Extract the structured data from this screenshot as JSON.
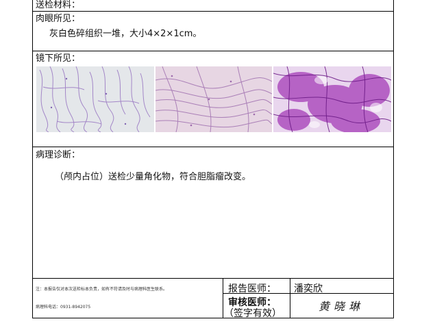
{
  "sections": {
    "specimen": {
      "label": "送检材料："
    },
    "gross": {
      "label": "肉眼所见：",
      "text": "灰白色碎组织一堆，大小4×2×1cm。"
    },
    "microscopic": {
      "label": "镜下所见：",
      "images": [
        {
          "name": "micrograph-1",
          "color": "#c9b2d6"
        },
        {
          "name": "micrograph-2",
          "color": "#cfb3c9"
        },
        {
          "name": "micrograph-3",
          "color": "#b04cbf"
        }
      ]
    },
    "diagnosis": {
      "label": "病理诊断：",
      "text": "（颅内占位）送检少量角化物，符合胆脂瘤改变。"
    }
  },
  "footer": {
    "note": "注：本报告仅对本次送检标本负责，如有不符请及时与病理科医生联系。",
    "phone": "病理科电话：0931-8942075",
    "report_doctor_label": "报告医师：",
    "report_doctor_name": "潘奕欣",
    "review_doctor_label": "审核医师：",
    "review_doctor_sub": "（签字有效）",
    "review_signature": "黄晓琳"
  }
}
